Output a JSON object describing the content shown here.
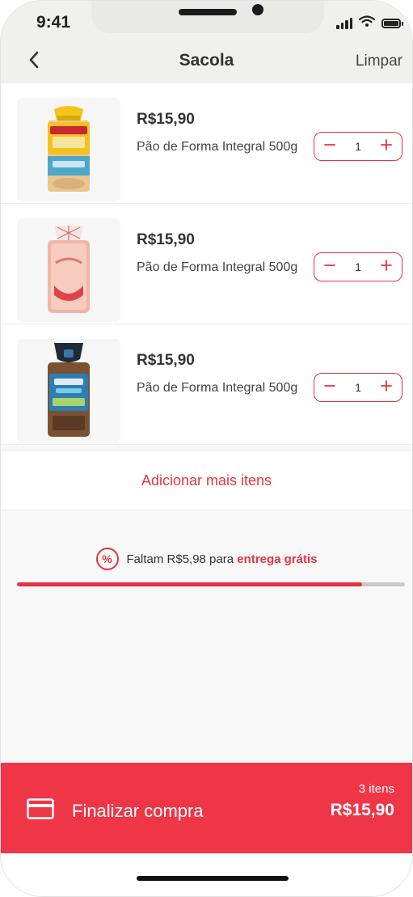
{
  "status_bar": {
    "time": "9:41"
  },
  "header": {
    "title": "Sacola",
    "clear_label": "Limpar",
    "back_icon": "chevron-left-icon"
  },
  "cart": {
    "items": [
      {
        "price": "R$15,90",
        "name": "Pão de Forma Integral 500g",
        "quantity": "1",
        "image": "bread-package-yellow"
      },
      {
        "price": "R$15,90",
        "name": "Pão de Forma Integral 500g",
        "quantity": "1",
        "image": "bread-package-white"
      },
      {
        "price": "R$15,90",
        "name": "Pão de Forma Integral 500g",
        "quantity": "1",
        "image": "bread-package-dark"
      }
    ],
    "add_more_label": "Adicionar mais itens"
  },
  "free_shipping": {
    "prefix": "Faltam R$5,98 para ",
    "highlight": "entrega grátis",
    "progress_fraction": 0.89
  },
  "checkout": {
    "label": "Finalizar compra",
    "item_count": "3 itens",
    "total": "R$15,90"
  },
  "colors": {
    "accent": "#E53342",
    "checkout_bg": "#EE3647",
    "header_bg": "#F0F0EE"
  }
}
